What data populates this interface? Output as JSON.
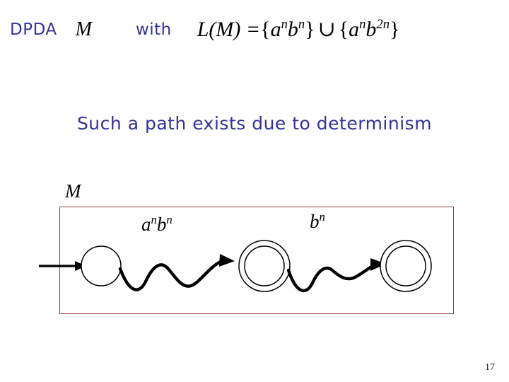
{
  "slide": {
    "title": {
      "prefix_label": "DPDA",
      "machine_symbol": "M",
      "connector_label": "with",
      "formula": {
        "lhs": "L(M) =",
        "set1_open": "{",
        "set1_base_a": "a",
        "set1_exp_a": "n",
        "set1_base_b": "b",
        "set1_exp_b": "n",
        "set1_close": "}",
        "union_symbol": "∪",
        "set2_open": "{",
        "set2_base_a": "a",
        "set2_exp_a": "n",
        "set2_base_b": "b",
        "set2_exp_b": "2n",
        "set2_close": "}",
        "plain_text": "L(M) = {a^n b^n} ∪ {a^n b^2n}"
      }
    },
    "subtitle": "Such a path exists due to determinism",
    "diagram": {
      "machine_label": "M",
      "states": [
        {
          "id": "q0",
          "type": "start",
          "accepting": false,
          "label": ""
        },
        {
          "id": "q1",
          "type": "accept",
          "accepting": true,
          "label": ""
        },
        {
          "id": "q2",
          "type": "accept",
          "accepting": true,
          "label": ""
        }
      ],
      "transitions": [
        {
          "from": "q0",
          "to": "q1",
          "style": "squiggly",
          "label_base_a": "a",
          "label_exp_a": "n",
          "label_base_b": "b",
          "label_exp_b": "n",
          "label_plain": "a^n b^n"
        },
        {
          "from": "q1",
          "to": "q2",
          "style": "squiggly",
          "label_base_b": "b",
          "label_exp_b": "n",
          "label_plain": "b^n"
        }
      ],
      "start_arrow": "start-arrow",
      "box_border_color": "#9E3B41"
    },
    "page_number": "17",
    "colors": {
      "heading_blue": "#333399",
      "box_border": "#9E3B41",
      "ink_black": "#000000",
      "background": "#ffffff"
    }
  }
}
